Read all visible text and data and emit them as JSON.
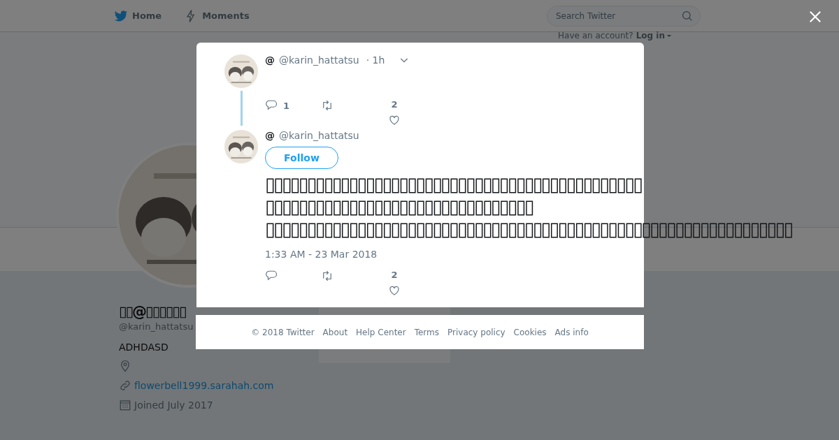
{
  "nav": {
    "items": [
      {
        "label": "Home",
        "kind": "home"
      },
      {
        "label": "Moments",
        "kind": "moments"
      }
    ]
  },
  "search": {
    "placeholder": "Search Twitter"
  },
  "login": {
    "prompt": "Have an account?",
    "link": "Log in"
  },
  "profile": {
    "name": "▯▯@▯▯▯▯▯▯",
    "handle": "@karin_hattatsu",
    "bio": "ADHDASD",
    "website": "flowerbell1999.sarahah.com",
    "joined": "Joined July 2017"
  },
  "modal": {
    "tweets": [
      {
        "kind": "parent",
        "name": "@",
        "handle": "@karin_hattatsu",
        "time": "· 1h",
        "replies": "1",
        "likes": "2"
      },
      {
        "kind": "focused",
        "name": "@",
        "handle": "@karin_hattatsu",
        "follow": "Follow",
        "lines": [
          "▯▯▯▯▯▯▯▯▯▯▯▯▯▯▯▯▯▯▯▯▯▯▯▯▯▯▯▯▯▯▯▯▯▯▯▯▯▯▯▯▯▯▯▯▯",
          "▯▯▯▯▯▯▯▯▯▯▯▯▯▯▯▯▯▯▯▯▯▯▯▯▯▯▯▯▯▯▯▯",
          "▯▯▯▯▯▯▯▯▯▯▯▯▯▯▯▯▯▯▯▯▯▯▯▯▯▯▯▯▯▯▯▯▯▯▯▯▯▯▯▯▯▯▯▯▯▯▯▯▯▯▯▯▯▯▯▯▯▯▯▯▯▯▯"
        ],
        "timestamp": "1:33 AM - 23 Mar 2018",
        "likes": "2"
      }
    ]
  },
  "footer": {
    "links": [
      "© 2018 Twitter",
      "About",
      "Help Center",
      "Terms",
      "Privacy policy",
      "Cookies",
      "Ads info"
    ]
  }
}
